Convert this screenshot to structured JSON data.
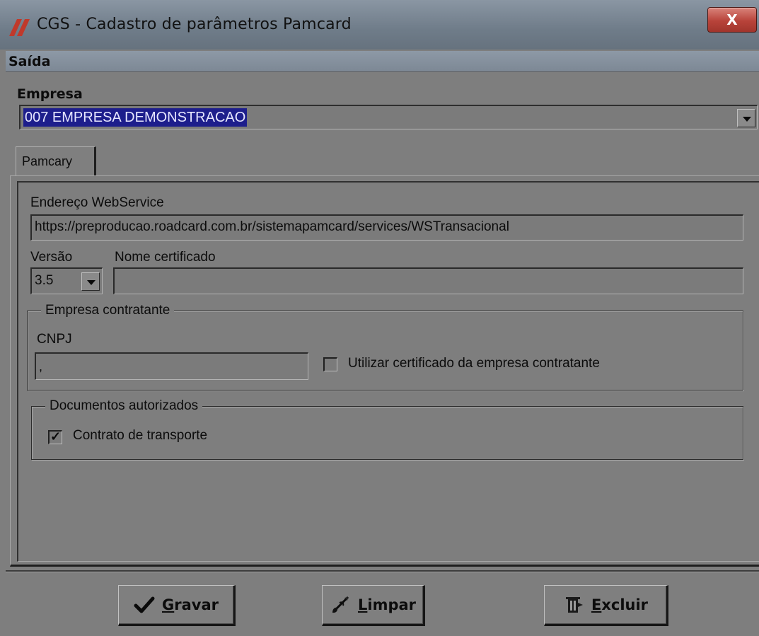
{
  "window": {
    "title": "CGS - Cadastro de parâmetros Pamcard",
    "close_glyph": "X"
  },
  "menu": {
    "items": [
      {
        "label": "Saída"
      }
    ]
  },
  "empresa": {
    "label": "Empresa",
    "selected": "007 EMPRESA DEMONSTRACAO"
  },
  "tabs": [
    {
      "label": "Pamcary"
    }
  ],
  "pamcary": {
    "webservice_label": "Endereço WebService",
    "webservice_value": "https://preproducao.roadcard.com.br/sistemapamcard/services/WSTransacional",
    "versao_label": "Versão",
    "versao_value": "3.5",
    "nome_certificado_label": "Nome certificado",
    "nome_certificado_value": "",
    "empresa_contratante": {
      "title": "Empresa contratante",
      "cnpj_label": "CNPJ",
      "cnpj_value": ",",
      "utilizar_certificado_label": "Utilizar certificado da empresa contratante",
      "utilizar_certificado_checked": false
    },
    "documentos_autorizados": {
      "title": "Documentos autorizados",
      "contrato_label": "Contrato de transporte",
      "contrato_checked": true
    }
  },
  "buttons": {
    "gravar": {
      "label_prefix": "G",
      "label_rest": "ravar"
    },
    "limpar": {
      "label_prefix": "L",
      "label_rest": "impar"
    },
    "excluir": {
      "label_prefix": "E",
      "label_rest": "xcluir"
    }
  },
  "colors": {
    "title_bar": "#6f7c89",
    "selection": "#1d1e8c",
    "close_button": "#b8433a",
    "logo": "#c0392b"
  },
  "icons": {
    "app": "app-logo-icon",
    "close": "close-icon",
    "gravar": "checkmark-icon",
    "limpar": "brush-icon",
    "excluir": "delete-icon"
  }
}
